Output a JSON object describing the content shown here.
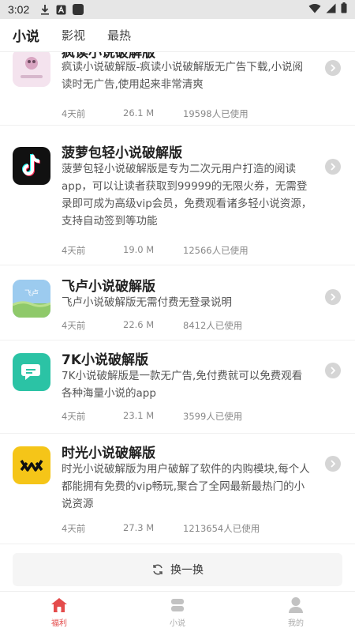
{
  "status_bar": {
    "time": "3:02",
    "icons": [
      "download-icon",
      "a-badge-icon",
      "app-square-icon",
      "wifi-icon",
      "signal-icon",
      "battery-icon"
    ]
  },
  "tabs": [
    {
      "label": "小说",
      "active": true
    },
    {
      "label": "影视",
      "active": false
    },
    {
      "label": "最热",
      "active": false
    }
  ],
  "items": [
    {
      "title": "疯读小说破解版",
      "description": "疯读小说破解版-疯读小说破解版无广告下载,小说阅读时无广告,使用起来非常清爽",
      "date": "4天前",
      "size": "26.1 M",
      "users": "19598人已使用",
      "icon": "fengdu-app-icon"
    },
    {
      "title": "菠萝包轻小说破解版",
      "description": "菠萝包轻小说破解版是专为二次元用户打造的阅读app，可以让读者获取到99999的无限火券，无需登录即可成为高级vip会员，免费观看诸多轻小说资源，支持自动签到等功能",
      "date": "4天前",
      "size": "19.0 M",
      "users": "12566人已使用",
      "icon": "tiktok-icon"
    },
    {
      "title": "飞卢小说破解版",
      "description": "飞卢小说破解版无需付费无登录说明",
      "date": "4天前",
      "size": "22.6 M",
      "users": "8412人已使用",
      "icon": "feilu-app-icon"
    },
    {
      "title": "7K小说破解版",
      "description": "7K小说破解版是一款无广告,免付费就可以免费观看各种海量小说的app",
      "date": "4天前",
      "size": "23.1 M",
      "users": "3599人已使用",
      "icon": "7k-app-icon"
    },
    {
      "title": "时光小说破解版",
      "description": "时光小说破解版为用户破解了软件的内购模块,每个人都能拥有免费的vip畅玩,聚合了全网最新最热门的小说资源",
      "date": "4天前",
      "size": "27.3 M",
      "users": "1213654人已使用",
      "icon": "shiguang-app-icon"
    }
  ],
  "refresh_label": "换一换",
  "bottom_nav": [
    {
      "label": "福利",
      "icon": "home-icon",
      "active": true
    },
    {
      "label": "小说",
      "icon": "book-icon",
      "active": false
    },
    {
      "label": "我的",
      "icon": "person-icon",
      "active": false
    }
  ],
  "colors": {
    "accent": "#e44b4b",
    "arrow": "#d5d5d5",
    "shiguang_yellow": "#f5c518",
    "sevenk_teal": "#2bc3a5"
  }
}
